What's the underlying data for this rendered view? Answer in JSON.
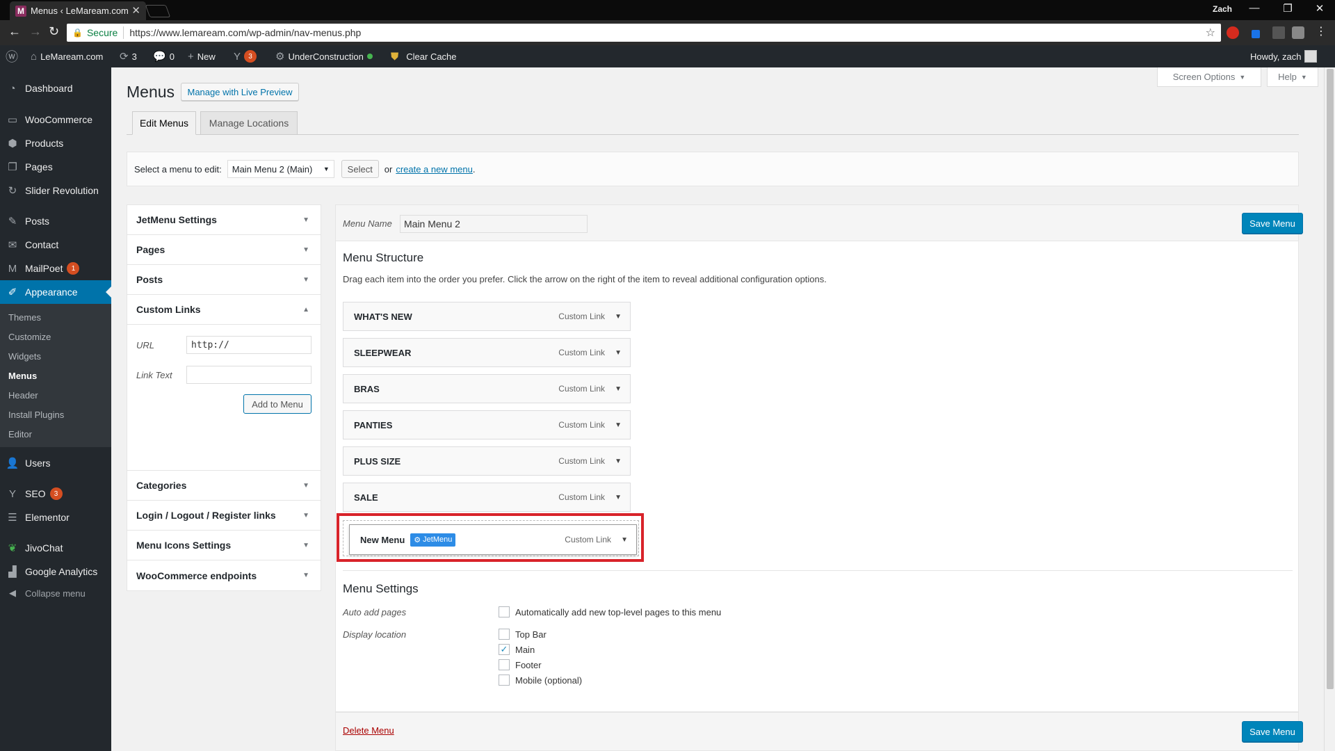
{
  "browser": {
    "tab_title": "Menus ‹ LeMaream.com",
    "tab_favicon": "M",
    "user": "Zach",
    "secure_label": "Secure",
    "url": "https://www.lemaream.com/wp-admin/nav-menus.php"
  },
  "adminbar": {
    "site_name": "LeMaream.com",
    "updates_count": "3",
    "comments_count": "0",
    "new_label": "New",
    "yoast_count": "3",
    "under_construction": "UnderConstruction",
    "clear_cache": "Clear Cache",
    "howdy": "Howdy, zach"
  },
  "sidebar": {
    "items": [
      {
        "label": "Dashboard",
        "icon": "dashboard-icon"
      },
      {
        "label": "WooCommerce",
        "icon": "woocommerce-icon"
      },
      {
        "label": "Products",
        "icon": "products-icon"
      },
      {
        "label": "Pages",
        "icon": "pages-icon"
      },
      {
        "label": "Slider Revolution",
        "icon": "slider-icon"
      },
      {
        "label": "Posts",
        "icon": "pin-icon"
      },
      {
        "label": "Contact",
        "icon": "mail-icon"
      },
      {
        "label": "MailPoet",
        "icon": "mailpoet-icon",
        "badge": "1"
      },
      {
        "label": "Appearance",
        "icon": "brush-icon"
      },
      {
        "label": "Users",
        "icon": "users-icon"
      },
      {
        "label": "SEO",
        "icon": "yoast-icon",
        "badge": "3"
      },
      {
        "label": "Elementor",
        "icon": "elementor-icon"
      },
      {
        "label": "JivoChat",
        "icon": "jivochat-icon"
      },
      {
        "label": "Google Analytics",
        "icon": "analytics-icon"
      }
    ],
    "submenu": [
      "Themes",
      "Customize",
      "Widgets",
      "Menus",
      "Header",
      "Install Plugins",
      "Editor"
    ],
    "collapse_label": "Collapse menu"
  },
  "header": {
    "title": "Menus",
    "live_preview": "Manage with Live Preview",
    "screen_options": "Screen Options",
    "help": "Help",
    "tabs": [
      "Edit Menus",
      "Manage Locations"
    ]
  },
  "select_menu": {
    "label": "Select a menu to edit:",
    "selected": "Main Menu 2 (Main)",
    "select_button": "Select",
    "or": "or",
    "create_link": "create a new menu",
    "period": "."
  },
  "accordion": {
    "sections": [
      "JetMenu Settings",
      "Pages",
      "Posts",
      "Custom Links",
      "Categories",
      "Login / Logout / Register links",
      "Menu Icons Settings",
      "WooCommerce endpoints"
    ],
    "url_label": "URL",
    "url_value": "http://",
    "link_text_label": "Link Text",
    "link_text_value": "",
    "add_button": "Add to Menu"
  },
  "menu": {
    "name_label": "Menu Name",
    "name_value": "Main Menu 2",
    "save_button": "Save Menu",
    "structure_title": "Menu Structure",
    "structure_desc": "Drag each item into the order you prefer. Click the arrow on the right of the item to reveal additional configuration options.",
    "items": [
      {
        "title": "WHAT'S NEW",
        "type": "Custom Link"
      },
      {
        "title": "SLEEPWEAR",
        "type": "Custom Link"
      },
      {
        "title": "BRAS",
        "type": "Custom Link"
      },
      {
        "title": "PANTIES",
        "type": "Custom Link"
      },
      {
        "title": "PLUS SIZE",
        "type": "Custom Link"
      },
      {
        "title": "SALE",
        "type": "Custom Link"
      }
    ],
    "new_item": {
      "title": "New Menu",
      "badge": "JetMenu",
      "type": "Custom Link"
    },
    "settings_title": "Menu Settings",
    "auto_add_label": "Auto add pages",
    "auto_add_option": "Automatically add new top-level pages to this menu",
    "display_label": "Display location",
    "locations": [
      {
        "label": "Top Bar",
        "checked": false
      },
      {
        "label": "Main",
        "checked": true
      },
      {
        "label": "Footer",
        "checked": false
      },
      {
        "label": "Mobile (optional)",
        "checked": false
      }
    ],
    "delete_link": "Delete Menu"
  },
  "colors": {
    "wp_blue": "#0073aa",
    "highlight_red": "#d8232a",
    "jetmenu_blue": "#2d8ce6"
  }
}
